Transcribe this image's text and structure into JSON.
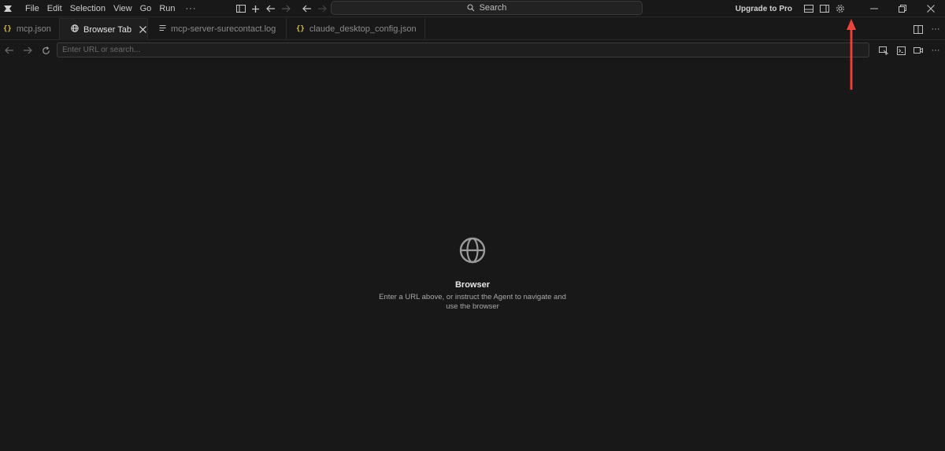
{
  "titlebar": {
    "menu": [
      "File",
      "Edit",
      "Selection",
      "View",
      "Go",
      "Run"
    ],
    "more": "···",
    "search_label": "Search",
    "upgrade_label": "Upgrade to Pro"
  },
  "tabs": [
    {
      "label": "mcp.json",
      "icon": "json-icon",
      "icon_text": "{}"
    },
    {
      "label": "Browser Tab",
      "icon": "globe-icon",
      "active": true
    },
    {
      "label": "mcp-server-surecontact.log",
      "icon": "lines-icon"
    },
    {
      "label": "claude_desktop_config.json",
      "icon": "json-icon",
      "icon_text": "{}"
    }
  ],
  "navbar": {
    "url_placeholder": "Enter URL or search..."
  },
  "browser": {
    "title": "Browser",
    "description": "Enter a URL above, or instruct the Agent to navigate and use the browser"
  },
  "annotation": {
    "arrow_color": "#e8453c"
  }
}
